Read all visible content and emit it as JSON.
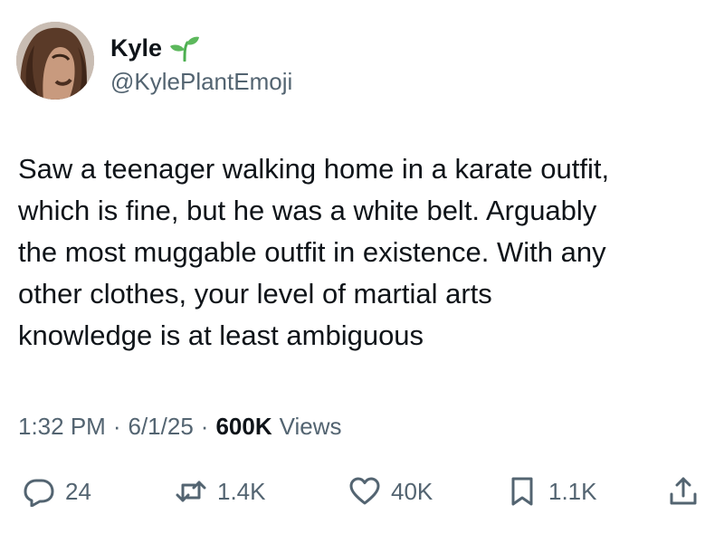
{
  "author": {
    "name": "Kyle",
    "name_icon": "sprout-icon",
    "handle": "@KylePlantEmoji"
  },
  "tweet": {
    "text": "Saw a teenager walking home in a karate outfit,\nwhich is fine, but he was a white belt. Arguably\nthe most muggable outfit in existence. With any\nother clothes, your level of martial arts\nknowledge is at least ambiguous"
  },
  "meta": {
    "time": "1:32 PM",
    "separator": "·",
    "date": "6/1/25",
    "views_count": "600K",
    "views_label": "Views"
  },
  "actions": {
    "reply": {
      "icon": "reply-icon",
      "count": "24"
    },
    "retweet": {
      "icon": "retweet-icon",
      "count": "1.4K"
    },
    "like": {
      "icon": "heart-icon",
      "count": "40K"
    },
    "bookmark": {
      "icon": "bookmark-icon",
      "count": "1.1K"
    },
    "share": {
      "icon": "share-icon"
    }
  },
  "colors": {
    "text_primary": "#0f1419",
    "text_secondary": "#536471",
    "sprout_green": "#4caf50",
    "background": "#ffffff"
  }
}
